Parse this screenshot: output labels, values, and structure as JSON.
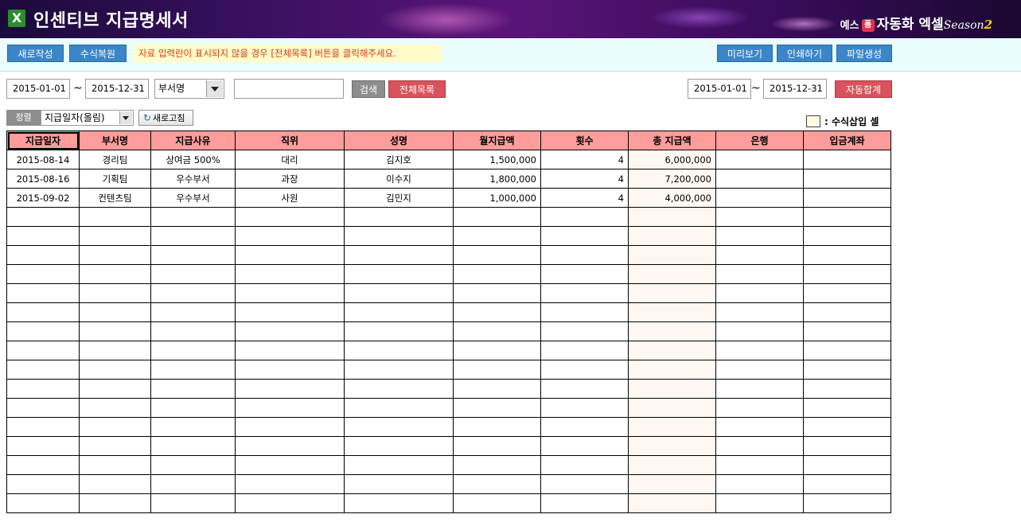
{
  "header": {
    "icon_label": "X",
    "title": "인센티브 지급명세서",
    "brand": {
      "part1": "예스",
      "badge": "폼",
      "part2": "자동화 엑셀",
      "season": "Season",
      "season_num": "2"
    }
  },
  "toolbar": {
    "new_label": "새로작성",
    "restore_label": "수식복원",
    "notice": "자료 입력란이 표시되지  않을 경우 [전체목록] 버튼을 클릭해주세요.",
    "preview_label": "미리보기",
    "print_label": "인쇄하기",
    "file_label": "파일생성"
  },
  "filter": {
    "date_from": "2015-01-01",
    "tilde": "~",
    "date_to": "2015-12-31",
    "field_select": "부서명",
    "search_value": "",
    "search_label": "검색",
    "all_label": "전체목록",
    "sum_date_from": "2015-01-01",
    "sum_date_to": "2015-12-31",
    "autosum_label": "자동합계"
  },
  "sort": {
    "label": "정렬",
    "value": "지급일자(올림)",
    "refresh_label": "새로고침"
  },
  "legend": {
    "text": ": 수식삽입 셀"
  },
  "table": {
    "headers": [
      "지급일자",
      "부서명",
      "지급사유",
      "직위",
      "성명",
      "월지급액",
      "횟수",
      "총 지급액",
      "은행",
      "입금계좌"
    ],
    "rows": [
      [
        "2015-08-14",
        "경리팀",
        "상여금 500%",
        "대리",
        "김지호",
        "1,500,000",
        "4",
        "6,000,000",
        "",
        ""
      ],
      [
        "2015-08-16",
        "기획팀",
        "우수부서",
        "과장",
        "이수지",
        "1,800,000",
        "4",
        "7,200,000",
        "",
        ""
      ],
      [
        "2015-09-02",
        "컨텐츠팀",
        "우수부서",
        "사원",
        "김민지",
        "1,000,000",
        "4",
        "4,000,000",
        "",
        ""
      ]
    ],
    "empty_rows": 16
  },
  "colors": {
    "header_bg": "#ff9c9c",
    "formula_cell": "#fff8f2",
    "button_blue": "#3a86c8",
    "button_red": "#d9525c",
    "toolbar_bg": "#eafcfc"
  }
}
